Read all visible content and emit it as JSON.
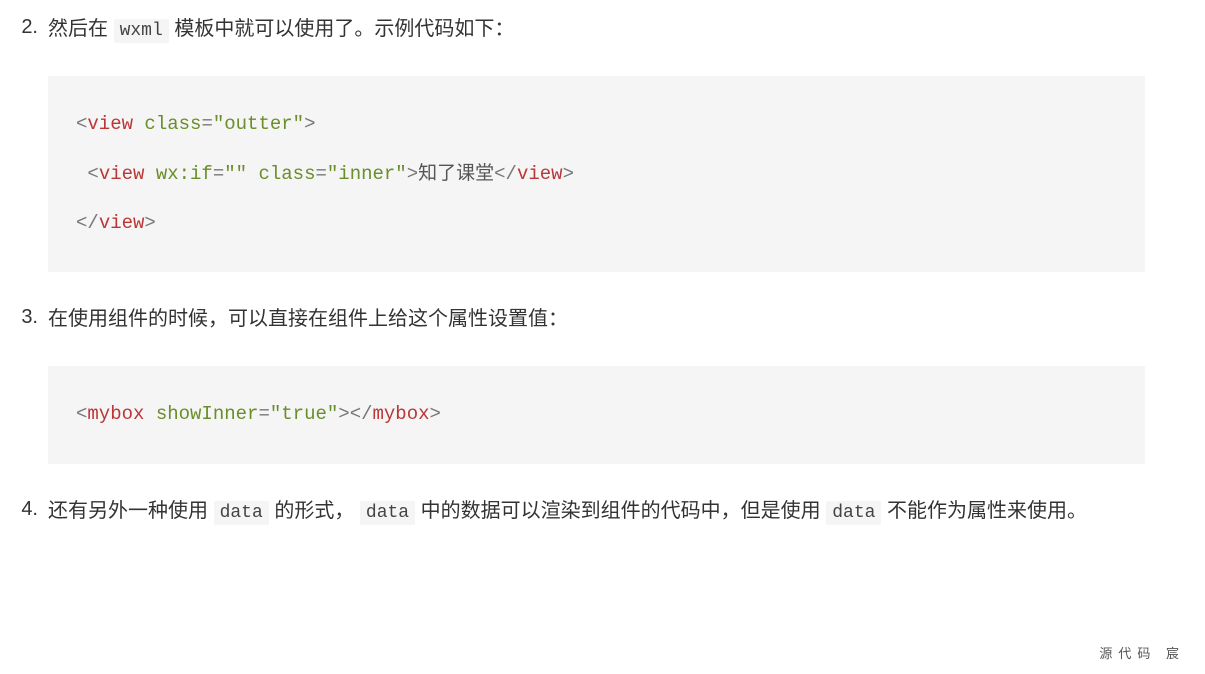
{
  "items": [
    {
      "num": "2.",
      "desc_prefix": "然后在 ",
      "desc_code": "wxml",
      "desc_suffix": " 模板中就可以使用了。示例代码如下：",
      "code": {
        "l1": {
          "open": "<",
          "tag": "view",
          "sp": " ",
          "attr": "class",
          "eq": "=",
          "val": "\"outter\"",
          "close": ">"
        },
        "l2": {
          "indent": " ",
          "open": "<",
          "tag": "view",
          "sp1": " ",
          "attr1": "wx:if",
          "eq1": "=",
          "val1": "\"\"",
          "sp2": " ",
          "attr2": "class",
          "eq2": "=",
          "val2": "\"inner\"",
          "close1": ">",
          "text": "知了课堂",
          "open2": "</",
          "tag2": "view",
          "close2": ">"
        },
        "l3": {
          "open": "</",
          "tag": "view",
          "close": ">"
        }
      }
    },
    {
      "num": "3.",
      "desc": "在使用组件的时候，可以直接在组件上给这个属性设置值：",
      "code": {
        "l1": {
          "open": "<",
          "tag": "mybox",
          "sp": " ",
          "attr": "showInner",
          "eq": "=",
          "val": "\"true\"",
          "close1": ">",
          "open2": "</",
          "tag2": "mybox",
          "close2": ">"
        }
      }
    },
    {
      "num": "4.",
      "parts": {
        "p1": "还有另外一种使用 ",
        "c1": "data",
        "p2": " 的形式， ",
        "c2": "data",
        "p3": " 中的数据可以渲染到组件的代码中，但是使用 ",
        "c3": "data",
        "p4": " 不能作为属性来使用。"
      }
    }
  ],
  "footer": "源代码 宸"
}
